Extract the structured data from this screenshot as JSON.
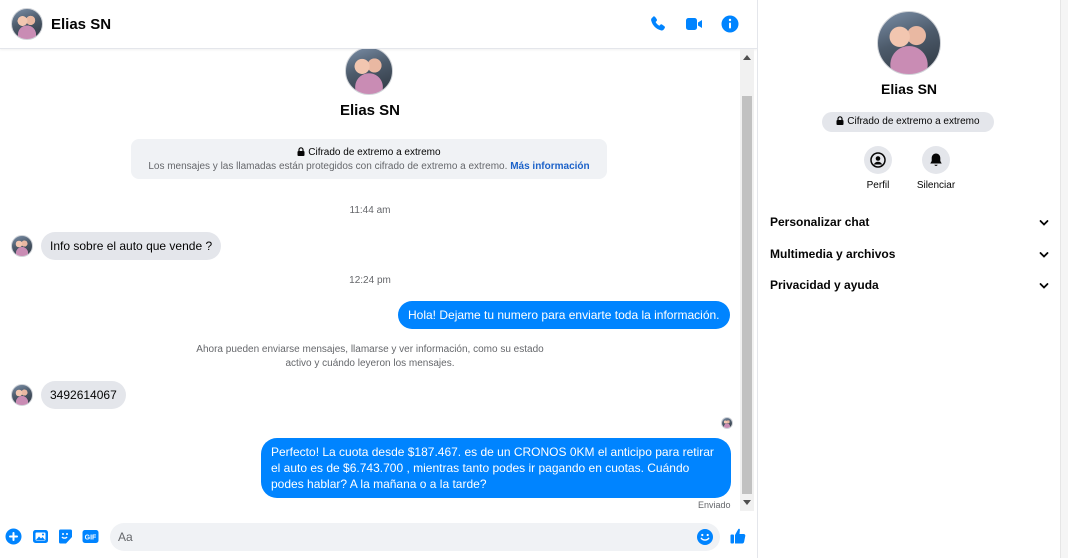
{
  "header": {
    "contact_name": "Elias SN"
  },
  "conversation": {
    "profile_name": "Elias SN",
    "e2e_title": "Cifrado de extremo a extremo",
    "e2e_text": "Los mensajes y las llamadas están protegidos con cifrado de extremo a extremo.",
    "e2e_link": "Más información",
    "time_1": "11:44 am",
    "msg_in_1": "Info sobre el auto que vende ?",
    "time_2": "12:24 pm",
    "msg_out_1": "Hola! Dejame tu numero  para enviarte toda la información.",
    "system_line1": "Ahora pueden enviarse mensajes, llamarse y ver información, como su estado",
    "system_line2": "activo y cuándo leyeron los mensajes.",
    "msg_in_2": "3492614067",
    "msg_out_2": "Perfecto! La cuota desde $187.467. es de un CRONOS 0KM el anticipo para retirar el auto es de $6.743.700 , mientras tanto podes ir pagando en cuotas. Cuándo podes hablar? A la mañana o a la tarde?",
    "sent_label": "Enviado"
  },
  "composer": {
    "placeholder": "Aa"
  },
  "info_panel": {
    "name": "Elias SN",
    "e2e_badge": "Cifrado de extremo a extremo",
    "actions": [
      {
        "label": "Perfil",
        "icon": "profile-icon"
      },
      {
        "label": "Silenciar",
        "icon": "bell-icon"
      }
    ],
    "sections": [
      "Personalizar chat",
      "Multimedia y archivos",
      "Privacidad y ayuda"
    ]
  },
  "colors": {
    "accent": "#0084ff",
    "bubble_in": "#e4e6eb",
    "panel_bg": "#f0f2f5",
    "link": "#1c62c9"
  }
}
